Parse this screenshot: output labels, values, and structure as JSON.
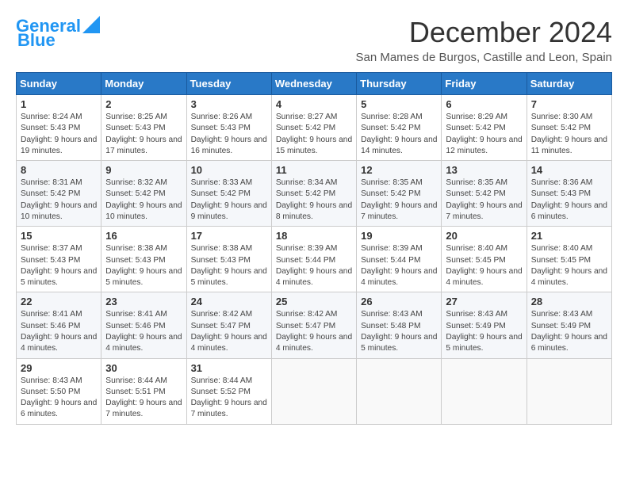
{
  "logo": {
    "part1": "General",
    "part2": "Blue"
  },
  "title": "December 2024",
  "location": "San Mames de Burgos, Castille and Leon, Spain",
  "days_of_week": [
    "Sunday",
    "Monday",
    "Tuesday",
    "Wednesday",
    "Thursday",
    "Friday",
    "Saturday"
  ],
  "weeks": [
    [
      {
        "day": 1,
        "sunrise": "8:24 AM",
        "sunset": "5:43 PM",
        "daylight": "9 hours and 19 minutes."
      },
      {
        "day": 2,
        "sunrise": "8:25 AM",
        "sunset": "5:43 PM",
        "daylight": "9 hours and 17 minutes."
      },
      {
        "day": 3,
        "sunrise": "8:26 AM",
        "sunset": "5:43 PM",
        "daylight": "9 hours and 16 minutes."
      },
      {
        "day": 4,
        "sunrise": "8:27 AM",
        "sunset": "5:42 PM",
        "daylight": "9 hours and 15 minutes."
      },
      {
        "day": 5,
        "sunrise": "8:28 AM",
        "sunset": "5:42 PM",
        "daylight": "9 hours and 14 minutes."
      },
      {
        "day": 6,
        "sunrise": "8:29 AM",
        "sunset": "5:42 PM",
        "daylight": "9 hours and 12 minutes."
      },
      {
        "day": 7,
        "sunrise": "8:30 AM",
        "sunset": "5:42 PM",
        "daylight": "9 hours and 11 minutes."
      }
    ],
    [
      {
        "day": 8,
        "sunrise": "8:31 AM",
        "sunset": "5:42 PM",
        "daylight": "9 hours and 10 minutes."
      },
      {
        "day": 9,
        "sunrise": "8:32 AM",
        "sunset": "5:42 PM",
        "daylight": "9 hours and 10 minutes."
      },
      {
        "day": 10,
        "sunrise": "8:33 AM",
        "sunset": "5:42 PM",
        "daylight": "9 hours and 9 minutes."
      },
      {
        "day": 11,
        "sunrise": "8:34 AM",
        "sunset": "5:42 PM",
        "daylight": "9 hours and 8 minutes."
      },
      {
        "day": 12,
        "sunrise": "8:35 AM",
        "sunset": "5:42 PM",
        "daylight": "9 hours and 7 minutes."
      },
      {
        "day": 13,
        "sunrise": "8:35 AM",
        "sunset": "5:42 PM",
        "daylight": "9 hours and 7 minutes."
      },
      {
        "day": 14,
        "sunrise": "8:36 AM",
        "sunset": "5:43 PM",
        "daylight": "9 hours and 6 minutes."
      }
    ],
    [
      {
        "day": 15,
        "sunrise": "8:37 AM",
        "sunset": "5:43 PM",
        "daylight": "9 hours and 5 minutes."
      },
      {
        "day": 16,
        "sunrise": "8:38 AM",
        "sunset": "5:43 PM",
        "daylight": "9 hours and 5 minutes."
      },
      {
        "day": 17,
        "sunrise": "8:38 AM",
        "sunset": "5:43 PM",
        "daylight": "9 hours and 5 minutes."
      },
      {
        "day": 18,
        "sunrise": "8:39 AM",
        "sunset": "5:44 PM",
        "daylight": "9 hours and 4 minutes."
      },
      {
        "day": 19,
        "sunrise": "8:39 AM",
        "sunset": "5:44 PM",
        "daylight": "9 hours and 4 minutes."
      },
      {
        "day": 20,
        "sunrise": "8:40 AM",
        "sunset": "5:45 PM",
        "daylight": "9 hours and 4 minutes."
      },
      {
        "day": 21,
        "sunrise": "8:40 AM",
        "sunset": "5:45 PM",
        "daylight": "9 hours and 4 minutes."
      }
    ],
    [
      {
        "day": 22,
        "sunrise": "8:41 AM",
        "sunset": "5:46 PM",
        "daylight": "9 hours and 4 minutes."
      },
      {
        "day": 23,
        "sunrise": "8:41 AM",
        "sunset": "5:46 PM",
        "daylight": "9 hours and 4 minutes."
      },
      {
        "day": 24,
        "sunrise": "8:42 AM",
        "sunset": "5:47 PM",
        "daylight": "9 hours and 4 minutes."
      },
      {
        "day": 25,
        "sunrise": "8:42 AM",
        "sunset": "5:47 PM",
        "daylight": "9 hours and 4 minutes."
      },
      {
        "day": 26,
        "sunrise": "8:43 AM",
        "sunset": "5:48 PM",
        "daylight": "9 hours and 5 minutes."
      },
      {
        "day": 27,
        "sunrise": "8:43 AM",
        "sunset": "5:49 PM",
        "daylight": "9 hours and 5 minutes."
      },
      {
        "day": 28,
        "sunrise": "8:43 AM",
        "sunset": "5:49 PM",
        "daylight": "9 hours and 6 minutes."
      }
    ],
    [
      {
        "day": 29,
        "sunrise": "8:43 AM",
        "sunset": "5:50 PM",
        "daylight": "9 hours and 6 minutes."
      },
      {
        "day": 30,
        "sunrise": "8:44 AM",
        "sunset": "5:51 PM",
        "daylight": "9 hours and 7 minutes."
      },
      {
        "day": 31,
        "sunrise": "8:44 AM",
        "sunset": "5:52 PM",
        "daylight": "9 hours and 7 minutes."
      },
      null,
      null,
      null,
      null
    ]
  ]
}
